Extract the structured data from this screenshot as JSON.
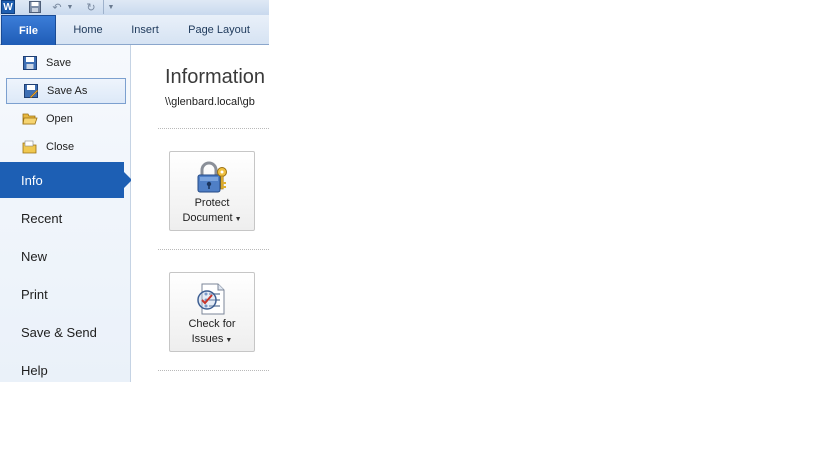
{
  "quick_access": {
    "app_icon": "word-app-icon",
    "word_letter": "W",
    "save_icon": "floppy-disk-icon",
    "undo_icon": "undo-arrow-icon",
    "redo_icon": "redo-arrow-icon",
    "customize_icon": "dropdown-caret-icon"
  },
  "tabs": [
    {
      "label": "File"
    },
    {
      "label": "Home"
    },
    {
      "label": "Insert"
    },
    {
      "label": "Page Layout"
    }
  ],
  "backstage": {
    "commands": [
      {
        "label": "Save",
        "icon": "floppy-disk-icon"
      },
      {
        "label": "Save As",
        "icon": "save-as-icon",
        "hovered": true
      },
      {
        "label": "Open",
        "icon": "open-folder-icon"
      },
      {
        "label": "Close",
        "icon": "close-folder-icon"
      }
    ],
    "nav": [
      {
        "label": "Info",
        "selected": true
      },
      {
        "label": "Recent"
      },
      {
        "label": "New"
      },
      {
        "label": "Print"
      },
      {
        "label": "Save & Send"
      },
      {
        "label": "Help"
      }
    ]
  },
  "info": {
    "title": "Information",
    "path": "\\\\glenbard.local\\gb",
    "buttons": [
      {
        "line1": "Protect",
        "line2": "Document",
        "icon": "padlock-key-icon"
      },
      {
        "line1": "Check for",
        "line2": "Issues",
        "icon": "checklist-inspect-icon"
      }
    ]
  },
  "colors": {
    "file_tab": "#1f5cb6",
    "selected_nav": "#1d5fb4",
    "ribbon_bg": "#d6e3f3"
  }
}
